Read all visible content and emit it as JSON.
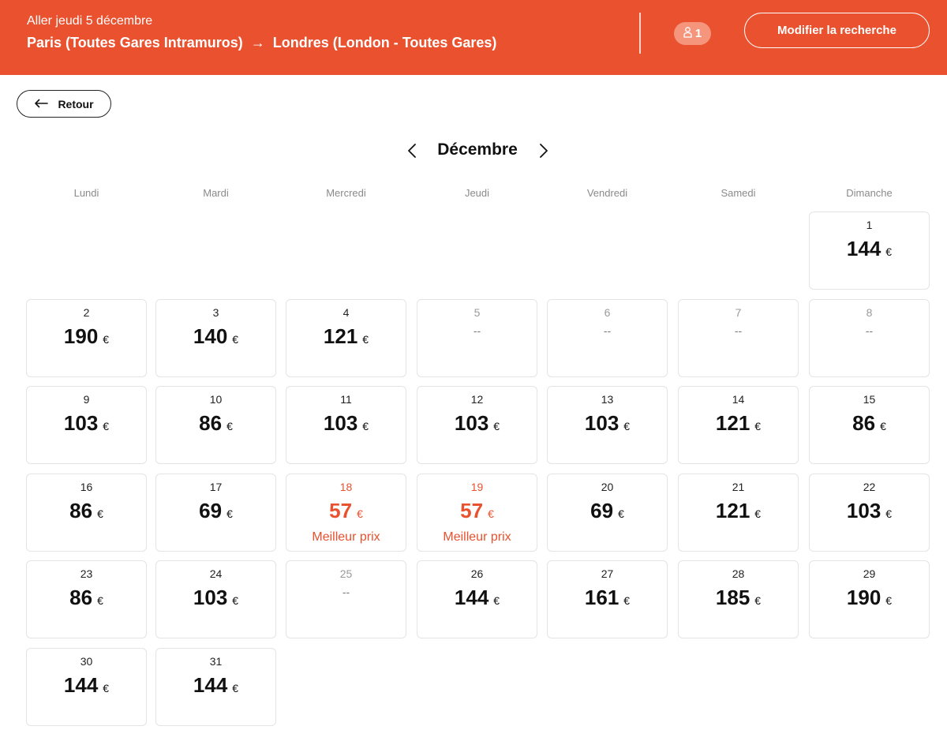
{
  "header": {
    "date_line": "Aller jeudi 5 décembre",
    "origin": "Paris (Toutes Gares Intramuros)",
    "destination": "Londres (London - Toutes Gares)",
    "passengers": "1",
    "modify_label": "Modifier la recherche",
    "accent_color": "#e9512f"
  },
  "back": {
    "label": "Retour"
  },
  "calendar": {
    "month": "Décembre",
    "weekdays": [
      "Lundi",
      "Mardi",
      "Mercredi",
      "Jeudi",
      "Vendredi",
      "Samedi",
      "Dimanche"
    ],
    "currency": "€",
    "best_label": "Meilleur prix",
    "first_weekday_index": 6,
    "days": [
      {
        "day": "1",
        "price": "144"
      },
      {
        "day": "2",
        "price": "190"
      },
      {
        "day": "3",
        "price": "140"
      },
      {
        "day": "4",
        "price": "121"
      },
      {
        "day": "5",
        "price": "--",
        "unavailable": true
      },
      {
        "day": "6",
        "price": "--",
        "unavailable": true
      },
      {
        "day": "7",
        "price": "--",
        "unavailable": true
      },
      {
        "day": "8",
        "price": "--",
        "unavailable": true
      },
      {
        "day": "9",
        "price": "103"
      },
      {
        "day": "10",
        "price": "86"
      },
      {
        "day": "11",
        "price": "103"
      },
      {
        "day": "12",
        "price": "103"
      },
      {
        "day": "13",
        "price": "103"
      },
      {
        "day": "14",
        "price": "121"
      },
      {
        "day": "15",
        "price": "86"
      },
      {
        "day": "16",
        "price": "86"
      },
      {
        "day": "17",
        "price": "69"
      },
      {
        "day": "18",
        "price": "57",
        "best": true
      },
      {
        "day": "19",
        "price": "57",
        "best": true
      },
      {
        "day": "20",
        "price": "69"
      },
      {
        "day": "21",
        "price": "121"
      },
      {
        "day": "22",
        "price": "103"
      },
      {
        "day": "23",
        "price": "86"
      },
      {
        "day": "24",
        "price": "103"
      },
      {
        "day": "25",
        "price": "--",
        "unavailable": true
      },
      {
        "day": "26",
        "price": "144"
      },
      {
        "day": "27",
        "price": "161"
      },
      {
        "day": "28",
        "price": "185"
      },
      {
        "day": "29",
        "price": "190"
      },
      {
        "day": "30",
        "price": "144"
      },
      {
        "day": "31",
        "price": "144"
      }
    ]
  }
}
